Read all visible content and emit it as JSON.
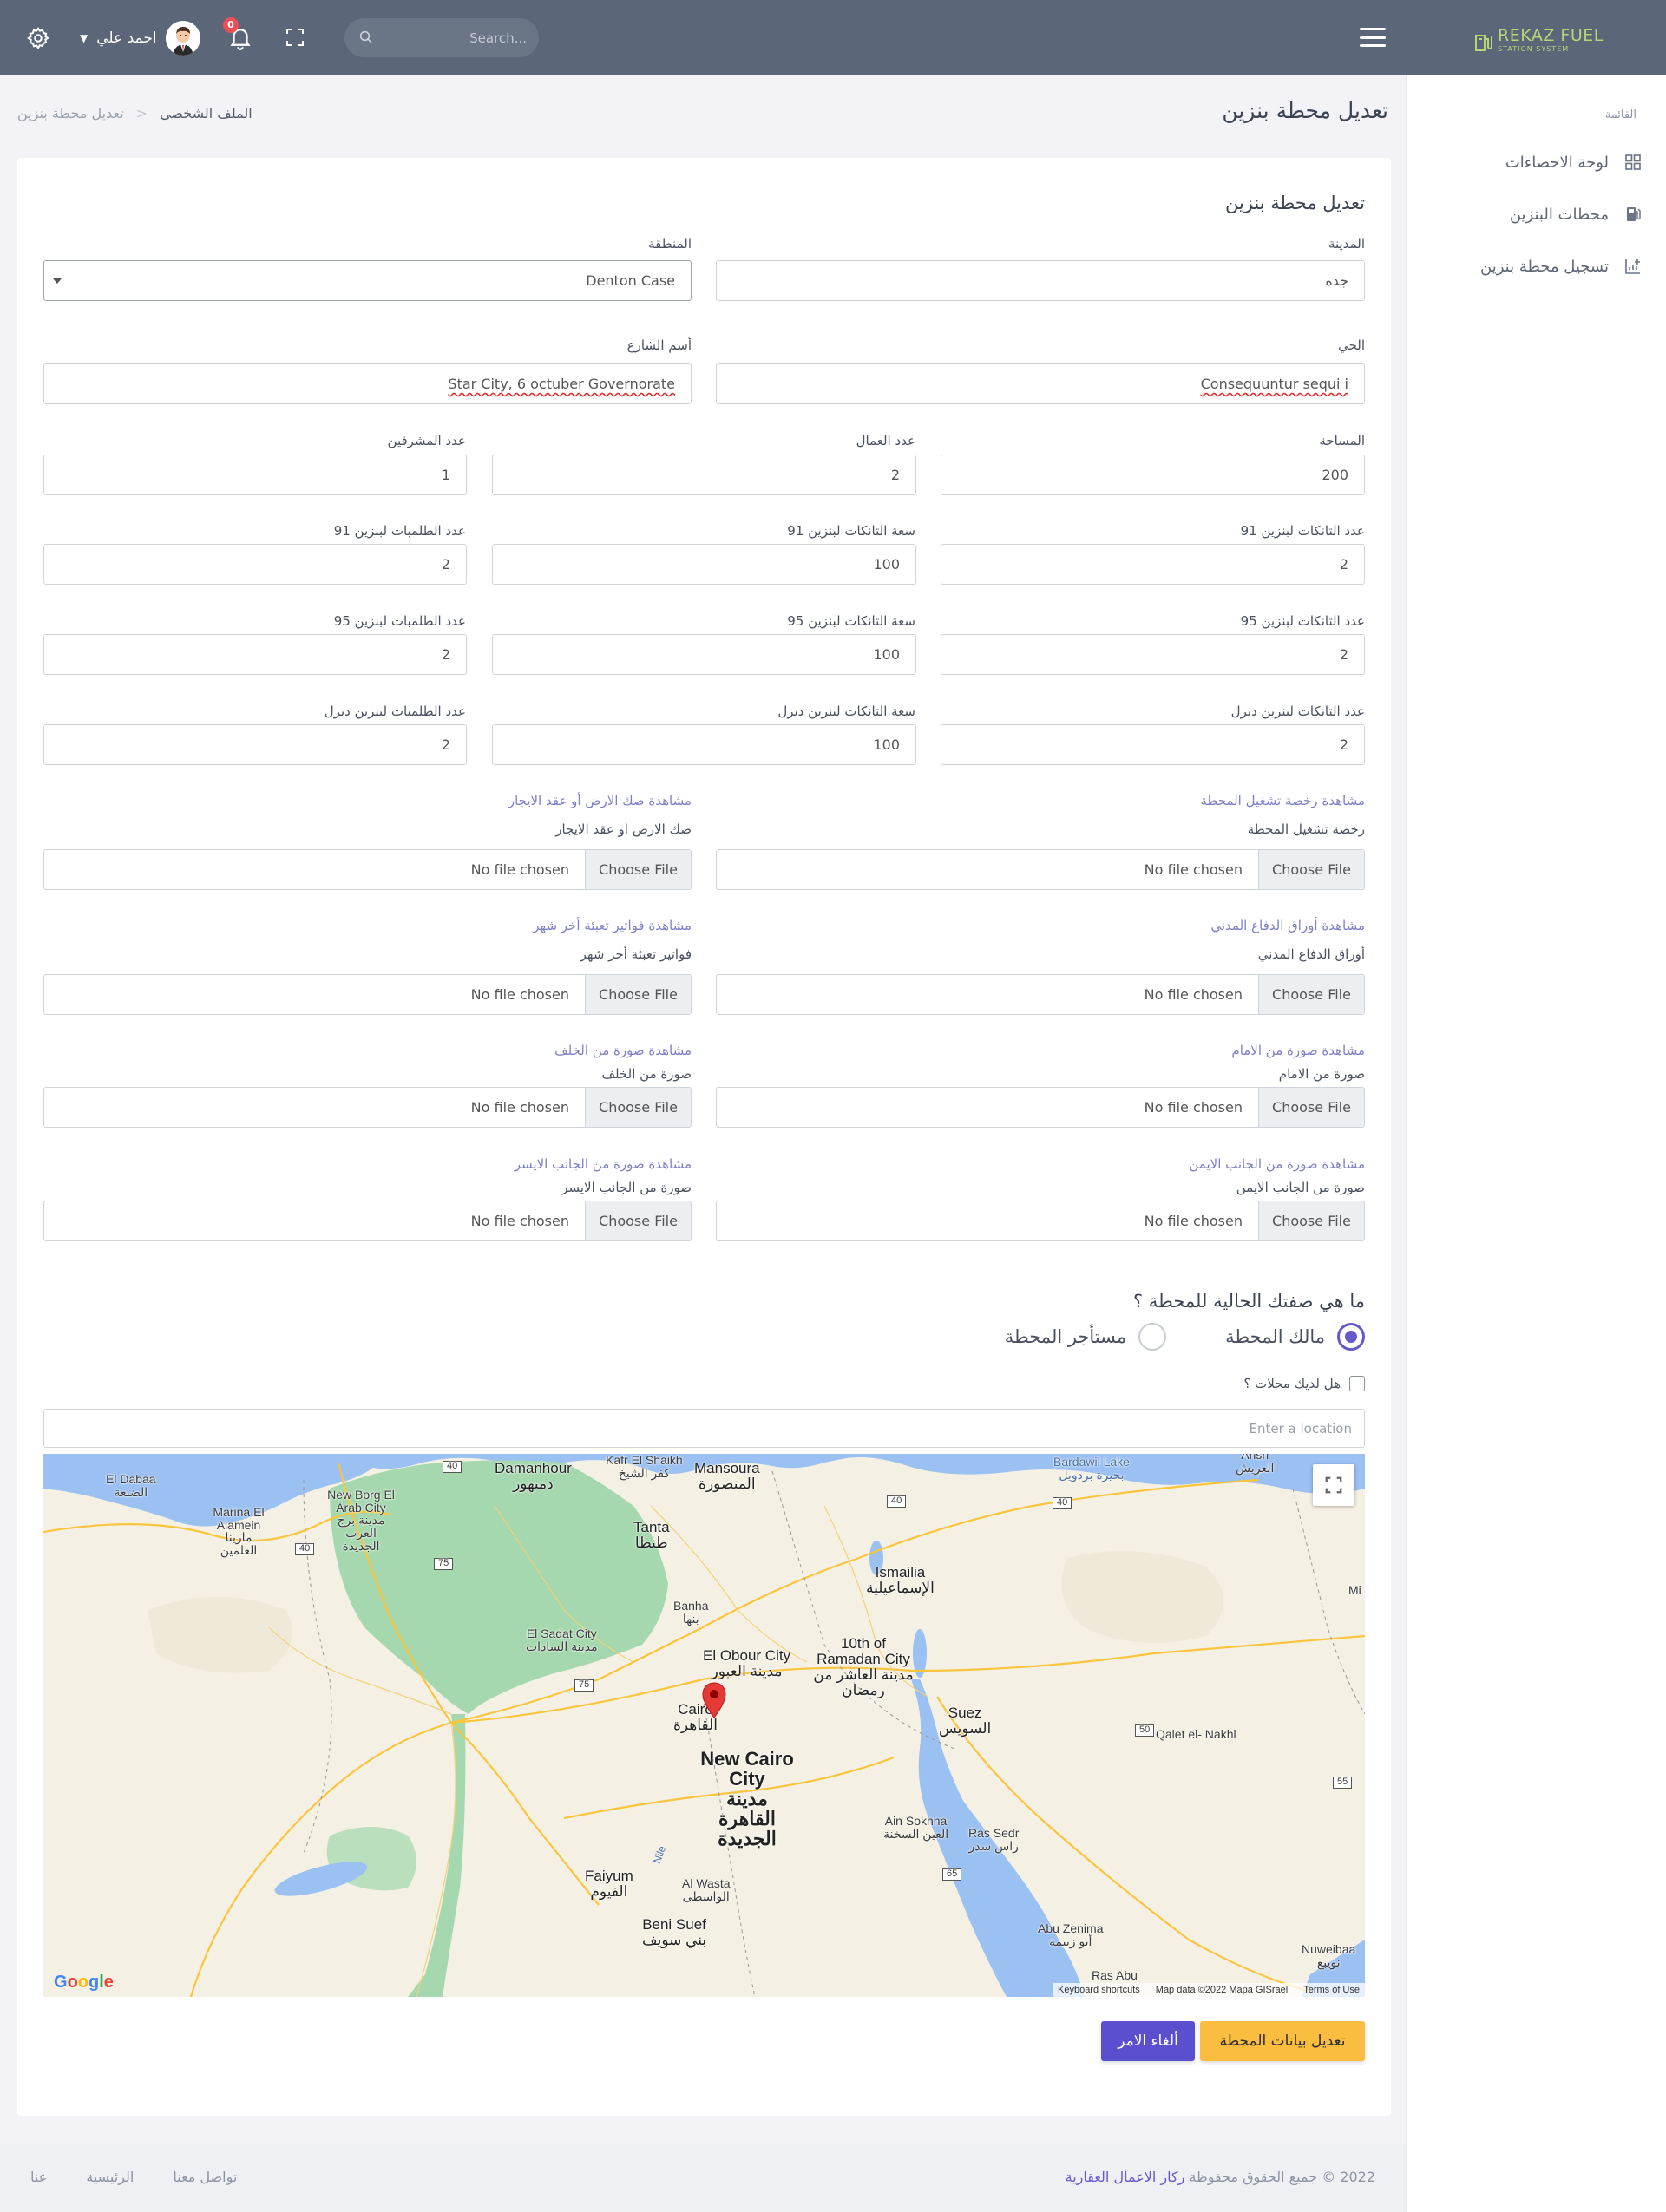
{
  "topbar": {
    "user_name": "احمد علي",
    "notifications_count": "0",
    "search_placeholder": "Search...",
    "brand_name": "REKAZ FUEL",
    "brand_sub": "STATION SYSTEM"
  },
  "sidebar": {
    "title": "القائمة",
    "items": [
      {
        "label": "لوحة الاحصاءات",
        "icon": "dashboard-icon"
      },
      {
        "label": "محطات البنزين",
        "icon": "gas-pump-icon"
      },
      {
        "label": "تسجيل محطة بنزين",
        "icon": "chart-add-icon"
      }
    ]
  },
  "page": {
    "title": "تعديل محطة بنزين",
    "breadcrumb": [
      "الملف الشخصي",
      "تعديل محطة بنزين"
    ]
  },
  "form": {
    "card_title": "تعديل محطة بنزين",
    "city_label": "المدينة",
    "city_value": "جده",
    "region_label": "المنطقة",
    "region_value": "Denton Case",
    "district_label": "الحي",
    "district_value": "Consequuntur sequi i",
    "street_label": "أسم الشارع",
    "street_value": "Star City, 6 octuber Governorate",
    "area_label": "المساحة",
    "area_value": "200",
    "workers_label": "عدد العمال",
    "workers_value": "2",
    "supervisors_label": "عدد المشرفين",
    "supervisors_value": "1",
    "tanks91_label": "عدد التانكات لبنزين 91",
    "tanks91_value": "2",
    "cap91_label": "سعة التانكات لبنزين 91",
    "cap91_value": "100",
    "pumps91_label": "عدد الطلمبات لبنزين 91",
    "pumps91_value": "2",
    "tanks95_label": "عدد التانكات لبنزين 95",
    "tanks95_value": "2",
    "cap95_label": "سعة التانكات لبنزين 95",
    "cap95_value": "100",
    "pumps95_label": "عدد الطلمبات لبنزين 95",
    "pumps95_value": "2",
    "tanksD_label": "عدد التانكات لبنزين ديزل",
    "tanksD_value": "2",
    "capD_label": "سعة التانكات لبنزين ديزل",
    "capD_value": "100",
    "pumpsD_label": "عدد الطلمبات لبنزين ديزل",
    "pumpsD_value": "2",
    "choose_file": "Choose File",
    "no_file": "No file chosen",
    "license_link": "مشاهدة رخصة تشغيل المحطة",
    "license_label": "رخصة تشغيل المحطة",
    "deed_link": "مشاهدة صك الارض أو عقد الايجار",
    "deed_label": "صك الارض او عقد الايجار",
    "civil_link": "مشاهدة أوراق الدفاع المدني",
    "civil_label": "أوراق الدفاع المدني",
    "bills_link": "مشاهدة فواتير تعبئة أخر شهر",
    "bills_label": "فواتير تعبئة أخر شهر",
    "front_link": "مشاهدة صورة من الامام",
    "front_label": "صورة من الامام",
    "back_link": "مشاهدة صورة من الخلف",
    "back_label": "صورة من الخلف",
    "right_link": "مشاهدة صورة من الجانب الايمن",
    "right_label": "صورة من الجانب الايمن",
    "left_link": "مشاهدة صورة من الجانب الايسر",
    "left_label": "صورة من الجانب الايسر",
    "question": "ما هي صفتك الحالية للمحطة ؟",
    "owner_label": "مالك المحطة",
    "tenant_label": "مستأجر المحطة",
    "shops_label": "هل لديك محلات ؟",
    "location_placeholder": "Enter a location",
    "save_label": "تعديل بيانات المحطة",
    "cancel_label": "ألغاء الامر"
  },
  "map": {
    "attribution": [
      "Keyboard shortcuts",
      "Map data ©2022 Mapa GISrael",
      "Terms of Use"
    ],
    "logo": "Google",
    "labels": {
      "damanhour": "Damanhour",
      "damanhour_ar": "دمنهور",
      "kafr": "Kafr El Shaikh",
      "kafr_ar": "كفر الشيخ",
      "mansoura": "Mansoura",
      "mansoura_ar": "المنصورة",
      "eldabaa": "El Dabaa",
      "eldabaa_ar": "الضبعة",
      "newborg": "New Borg El Arab City",
      "newborg_ar": "مدينة برج العرب الجديدة",
      "marina": "Marina El Alamein",
      "marina_ar": "مارينا العلمين",
      "tanta": "Tanta",
      "tanta_ar": "طنطا",
      "banha": "Banha",
      "banha_ar": "بنها",
      "ismailia": "Ismailia",
      "ismailia_ar": "الإسماعيلية",
      "bardawil": "Bardawil Lake",
      "bardawil_ar": "بحيرة بردويل",
      "arish": "Arish",
      "arish_ar": "العريش",
      "sadat": "El Sadat City",
      "sadat_ar": "مدينة السادات",
      "obour": "El Obour City",
      "obour_ar": "مدينة العبور",
      "ramadan": "10th of Ramadan City",
      "ramadan_ar": "مدينة العاشر من رمضان",
      "cairo": "Cairo",
      "cairo_ar": "القاهرة",
      "newcairo": "New Cairo City",
      "newcairo_ar": "مدينة القاهرة الجديدة",
      "suez": "Suez",
      "suez_ar": "السويس",
      "qalet": "Qalet el- Nakhl",
      "sokhna": "Ain Sokhna",
      "sokhna_ar": "العين السخنة",
      "rassedr": "Ras Sedr",
      "rassedr_ar": "راس سدر",
      "fayoum": "Faiyum",
      "fayoum_ar": "الفيوم",
      "wasta": "Al Wasta",
      "wasta_ar": "الواسطى",
      "benisuef": "Beni Suef",
      "benisuef_ar": "بني سويف",
      "abuzenima": "Abu Zenima",
      "abuzenima_ar": "أبو زنيمة",
      "rasabu": "Ras Abu",
      "nuweiba": "Nuweibaa",
      "nuweiba_ar": "نويبع",
      "mi": "Mi",
      "nile": "Nile"
    },
    "shields": [
      "40",
      "40",
      "40",
      "40",
      "75",
      "75",
      "50",
      "55",
      "65"
    ]
  },
  "footer": {
    "copyright_prefix": "2022 © جميع الحقوق محفوظة",
    "company": "ركاز الاعمال العقارية",
    "links": [
      "تواصل معنا",
      "الرئيسية",
      "عنا"
    ]
  }
}
